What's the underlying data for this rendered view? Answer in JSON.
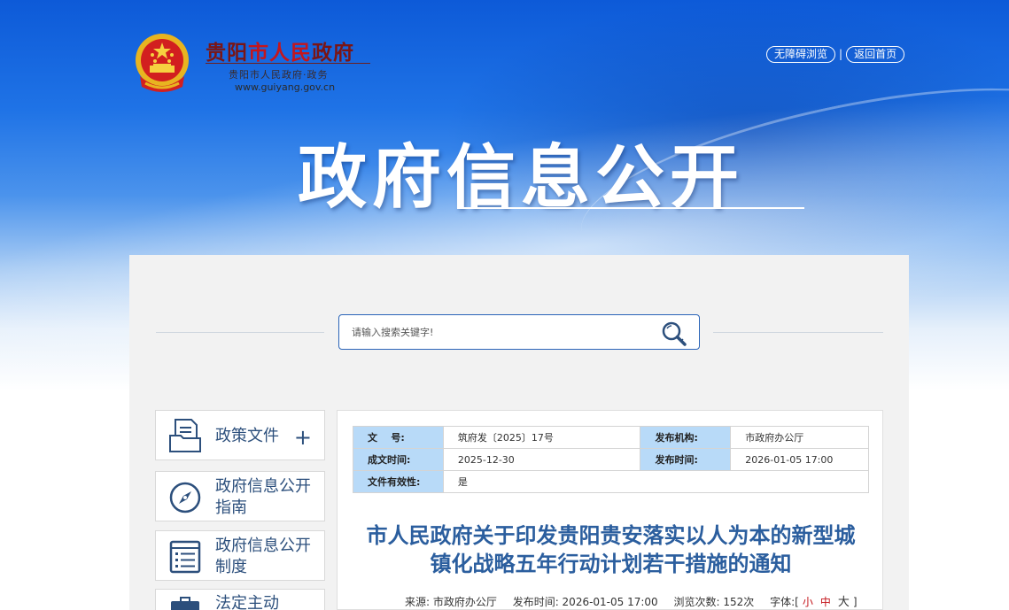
{
  "header": {
    "site_name_prefix": "贵阳",
    "site_name_highlight": "市人民",
    "site_name_suffix": "政府",
    "site_sub": "贵阳市人民政府·政务",
    "site_url": "www.guiyang.gov.cn",
    "links": {
      "accessible": "无障碍浏览",
      "separator": "|",
      "home": "返回首页"
    }
  },
  "hero": {
    "title": "政府信息公开"
  },
  "search": {
    "placeholder": "请输入搜索关键字!"
  },
  "sidebar": {
    "items": [
      {
        "label": "政策文件",
        "icon": "document-folder-icon",
        "expand": "+"
      },
      {
        "label": "政府信息公开指南",
        "icon": "compass-icon"
      },
      {
        "label": "政府信息公开制度",
        "icon": "list-document-icon"
      },
      {
        "label": "法定主动",
        "icon": "briefcase-icon"
      }
    ]
  },
  "document": {
    "meta": {
      "doc_no_label": "文    号:",
      "doc_no_value": "筑府发〔2025〕17号",
      "issuer_label": "发布机构:",
      "issuer_value": "市政府办公厅",
      "created_label": "成文时间:",
      "created_value": "2025-12-30",
      "published_label": "发布时间:",
      "published_value": "2026-01-05 17:00",
      "valid_label": "文件有效性:",
      "valid_value": "是"
    },
    "title": "市人民政府关于印发贵阳贵安落实以人为本的新型城镇化战略五年行动计划若干措施的通知",
    "info": {
      "source": "来源: 市政府办公厅",
      "time": "发布时间: 2026-01-05 17:00",
      "views": "浏览次数: 152次",
      "font_label": "字体:[",
      "font_small": "小",
      "font_medium": "中",
      "font_large": "大",
      "font_end": "]"
    }
  },
  "colors": {
    "title_blue": "#2b5e9e",
    "meta_key_bg": "#b8daf8",
    "brand_red": "#c4161c"
  }
}
